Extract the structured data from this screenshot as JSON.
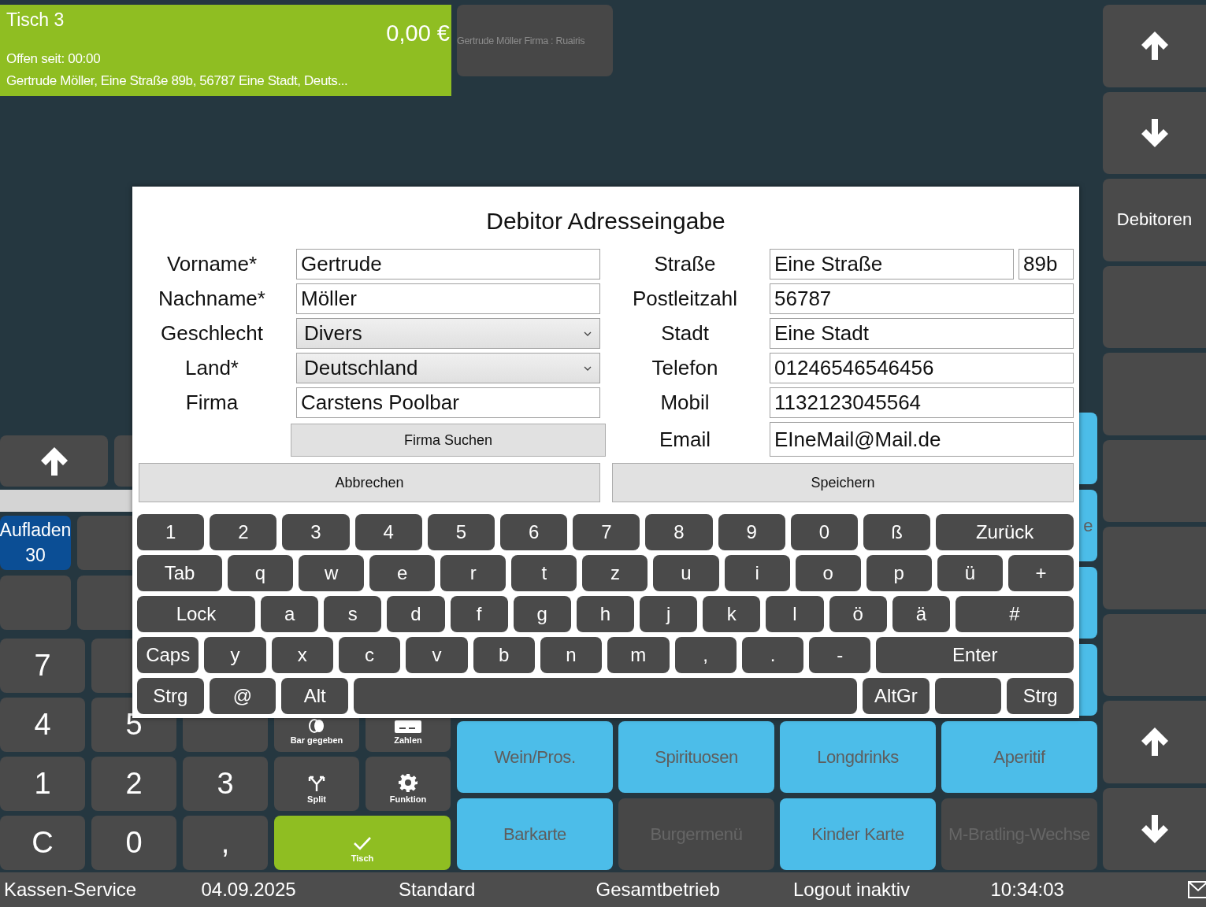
{
  "ticket": {
    "title": "Tisch 3",
    "total": "0,00 €",
    "open_since": "Offen seit: 00:00",
    "address": "Gertrude Möller, Eine Straße 89b, 56787 Eine Stadt, Deuts..."
  },
  "customer_card": {
    "text": "Gertrude Möller Firma : Ruairis"
  },
  "quick_buttons": [
    {
      "label": "Aufladen",
      "value": "30"
    }
  ],
  "numpad": [
    [
      {
        "label": "7",
        "kind": "digit"
      },
      {
        "kind": "digit"
      }
    ],
    [
      {
        "label": "4",
        "kind": "digit"
      },
      {
        "label": "5",
        "kind": "digit"
      },
      {
        "kind": "digit"
      },
      {
        "label": "Bar gegeben",
        "kind": "cash"
      },
      {
        "label": "Zahlen",
        "kind": "pay"
      }
    ],
    [
      {
        "label": "1",
        "kind": "digit"
      },
      {
        "label": "2",
        "kind": "digit"
      },
      {
        "label": "3",
        "kind": "digit"
      },
      {
        "label": "Split",
        "kind": "split"
      },
      {
        "label": "Funktion",
        "kind": "function"
      }
    ],
    [
      {
        "label": "C",
        "kind": "digit"
      },
      {
        "label": "0",
        "kind": "digit"
      },
      {
        "label": ",",
        "kind": "digit"
      },
      {
        "label": "Tisch",
        "kind": "confirm"
      }
    ]
  ],
  "category_tiles": [
    [
      {
        "color": "#4cbde9"
      }
    ],
    [
      {
        "label": "e",
        "color": "#4cbde9"
      }
    ],
    [
      {
        "color": "#4cbde9"
      }
    ],
    [
      {
        "color": "#4cbde9"
      }
    ],
    [
      {
        "label": "Wein/Pros.",
        "color": "#4cbde9"
      },
      {
        "label": "Spirituosen",
        "color": "#4cbde9"
      },
      {
        "label": "Longdrinks",
        "color": "#4cbde9"
      },
      {
        "label": "Aperitif",
        "color": "#4cbde9"
      }
    ],
    [
      {
        "label": "Barkarte",
        "color": "#4cbde9"
      },
      {
        "label": "Burgermenü",
        "color": "#474747"
      },
      {
        "label": "Kinder Karte",
        "color": "#4cbde9"
      },
      {
        "label": "M-Bratling-Wechse",
        "color": "#474747"
      }
    ]
  ],
  "side_buttons": [
    {
      "kind": "up"
    },
    {
      "kind": "down"
    },
    {
      "kind": "label",
      "label": "Debitoren"
    },
    {
      "kind": "empty"
    },
    {
      "kind": "empty"
    },
    {
      "kind": "empty"
    },
    {
      "kind": "empty"
    },
    {
      "kind": "empty"
    },
    {
      "kind": "up"
    },
    {
      "kind": "down"
    }
  ],
  "dialog": {
    "title": "Debitor Adresseingabe",
    "left_fields": [
      {
        "label": "Vorname*",
        "value": "Gertrude",
        "kind": "text"
      },
      {
        "label": "Nachname*",
        "value": "Möller",
        "kind": "text"
      },
      {
        "label": "Geschlecht",
        "value": "Divers",
        "kind": "select"
      },
      {
        "label": "Land*",
        "value": "Deutschland",
        "kind": "select"
      },
      {
        "label": "Firma",
        "value": "Carstens Poolbar",
        "kind": "text"
      }
    ],
    "search_button": "Firma Suchen",
    "right_fields": [
      {
        "label": "Straße",
        "value": "Eine Straße",
        "number": "89b"
      },
      {
        "label": "Postleitzahl",
        "value": "56787"
      },
      {
        "label": "Stadt",
        "value": "Eine Stadt"
      },
      {
        "label": "Telefon",
        "value": "01246546546456"
      },
      {
        "label": "Mobil",
        "value": "1132123045564"
      },
      {
        "label": "Email",
        "value": "EIneMail@Mail.de"
      }
    ],
    "cancel_button": "Abbrechen",
    "save_button": "Speichern",
    "keyboard": [
      [
        {
          "label": "1",
          "kind": "char"
        },
        {
          "label": "2",
          "kind": "char"
        },
        {
          "label": "3",
          "kind": "char"
        },
        {
          "label": "4",
          "kind": "char"
        },
        {
          "label": "5",
          "kind": "char"
        },
        {
          "label": "6",
          "kind": "char"
        },
        {
          "label": "7",
          "kind": "char"
        },
        {
          "label": "8",
          "kind": "char"
        },
        {
          "label": "9",
          "kind": "char"
        },
        {
          "label": "0",
          "kind": "char"
        },
        {
          "label": "ß",
          "kind": "char"
        },
        {
          "label": "Zurück",
          "kind": "wide"
        }
      ],
      [
        {
          "label": "Tab",
          "kind": "tab"
        },
        {
          "label": "q",
          "kind": "char"
        },
        {
          "label": "w",
          "kind": "char"
        },
        {
          "label": "e",
          "kind": "char"
        },
        {
          "label": "r",
          "kind": "char"
        },
        {
          "label": "t",
          "kind": "char"
        },
        {
          "label": "z",
          "kind": "char"
        },
        {
          "label": "u",
          "kind": "char"
        },
        {
          "label": "i",
          "kind": "char"
        },
        {
          "label": "o",
          "kind": "char"
        },
        {
          "label": "p",
          "kind": "char"
        },
        {
          "label": "ü",
          "kind": "char"
        },
        {
          "label": "+",
          "kind": "char"
        }
      ],
      [
        {
          "label": "Lock",
          "kind": "wide"
        },
        {
          "label": "a",
          "kind": "char"
        },
        {
          "label": "s",
          "kind": "char"
        },
        {
          "label": "d",
          "kind": "char"
        },
        {
          "label": "f",
          "kind": "char"
        },
        {
          "label": "g",
          "kind": "char"
        },
        {
          "label": "h",
          "kind": "char"
        },
        {
          "label": "j",
          "kind": "char"
        },
        {
          "label": "k",
          "kind": "char"
        },
        {
          "label": "l",
          "kind": "char"
        },
        {
          "label": "ö",
          "kind": "char"
        },
        {
          "label": "ä",
          "kind": "char"
        },
        {
          "label": "#",
          "kind": "wide"
        }
      ],
      [
        {
          "label": "Caps",
          "kind": "char"
        },
        {
          "label": "y",
          "kind": "char"
        },
        {
          "label": "x",
          "kind": "char"
        },
        {
          "label": "c",
          "kind": "char"
        },
        {
          "label": "v",
          "kind": "char"
        },
        {
          "label": "b",
          "kind": "char"
        },
        {
          "label": "n",
          "kind": "char"
        },
        {
          "label": "m",
          "kind": "char"
        },
        {
          "label": ",",
          "kind": "char"
        },
        {
          "label": ".",
          "kind": "char"
        },
        {
          "label": "-",
          "kind": "char"
        },
        {
          "label": "Enter",
          "kind": "enter"
        }
      ],
      [
        {
          "label": "Strg",
          "kind": "char"
        },
        {
          "label": "@",
          "kind": "char"
        },
        {
          "label": "Alt",
          "kind": "char"
        },
        {
          "kind": "space"
        },
        {
          "label": "AltGr",
          "kind": "char"
        },
        {
          "kind": "char"
        },
        {
          "label": "Strg",
          "kind": "char"
        }
      ]
    ]
  },
  "status_bar": [
    "Kassen-Service",
    "04.09.2025",
    "Standard",
    "Gesamtbetrieb",
    "Logout inaktiv",
    "10:34:03"
  ]
}
